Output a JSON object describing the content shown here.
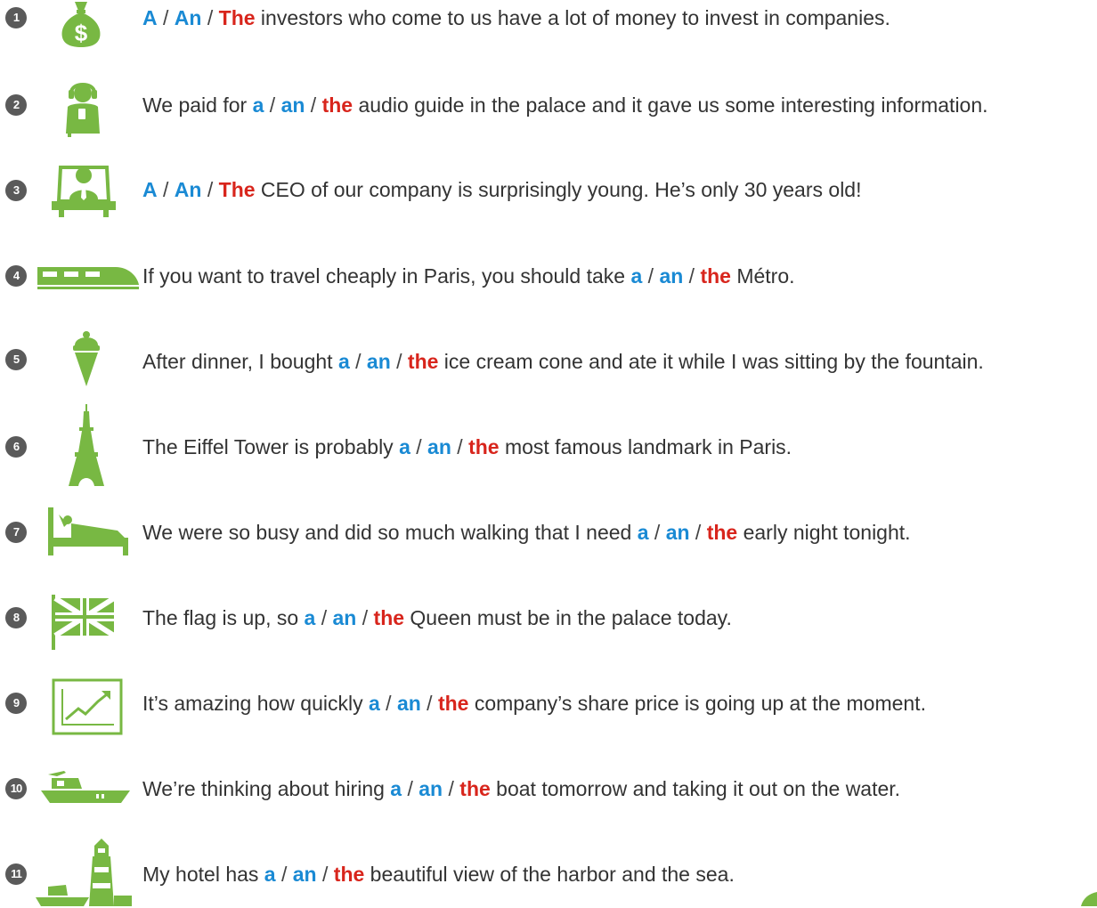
{
  "colors": {
    "icon_green": "#78b843",
    "article_a": "#1a8ad4",
    "article_an": "#1a8ad4",
    "article_the": "#d8251c",
    "badge": "#5a5a5a",
    "text": "#333333"
  },
  "items": [
    {
      "number": "1",
      "icon": "money-bag-icon",
      "before": "",
      "a": "A",
      "an": "An",
      "the": "The",
      "after": " investors who come to us have a lot of money to invest in companies."
    },
    {
      "number": "2",
      "icon": "audio-guide-icon",
      "before": "We paid for ",
      "a": "a",
      "an": "an",
      "the": "the",
      "after": " audio guide in the palace and it gave us some interesting information."
    },
    {
      "number": "3",
      "icon": "ceo-icon",
      "before": "",
      "a": "A",
      "an": "An",
      "the": "The",
      "after": " CEO of our company is surprisingly young. He’s only 30 years old!"
    },
    {
      "number": "4",
      "icon": "train-icon",
      "before": "If you want to travel cheaply in Paris, you should take ",
      "a": "a",
      "an": "an",
      "the": "the",
      "after": " Métro."
    },
    {
      "number": "5",
      "icon": "ice-cream-icon",
      "before": "After dinner, I bought ",
      "a": "a",
      "an": "an",
      "the": "the",
      "after": " ice cream cone and ate it while I was sitting by the fountain."
    },
    {
      "number": "6",
      "icon": "eiffel-tower-icon",
      "before": "The Eiffel Tower is probably ",
      "a": "a",
      "an": "an",
      "the": "the",
      "after": " most famous landmark in Paris."
    },
    {
      "number": "7",
      "icon": "bed-icon",
      "before": "We were so busy and did so much walking that I need ",
      "a": "a",
      "an": "an",
      "the": "the",
      "after": " early night tonight."
    },
    {
      "number": "8",
      "icon": "union-flag-icon",
      "before": "The flag is up, so ",
      "a": "a",
      "an": "an",
      "the": "the",
      "after": " Queen must be in the palace today."
    },
    {
      "number": "9",
      "icon": "rising-chart-icon",
      "before": "It’s amazing how quickly ",
      "a": "a",
      "an": "an",
      "the": "the",
      "after": " company’s share price is going up at the moment."
    },
    {
      "number": "10",
      "icon": "boat-icon",
      "before": "We’re thinking about hiring ",
      "a": "a",
      "an": "an",
      "the": "the",
      "after": " boat tomorrow and taking it out on the water."
    },
    {
      "number": "11",
      "icon": "lighthouse-harbor-icon",
      "before": "My hotel has ",
      "a": "a",
      "an": "an",
      "the": "the",
      "after": " beautiful view of the harbor and the sea."
    }
  ]
}
